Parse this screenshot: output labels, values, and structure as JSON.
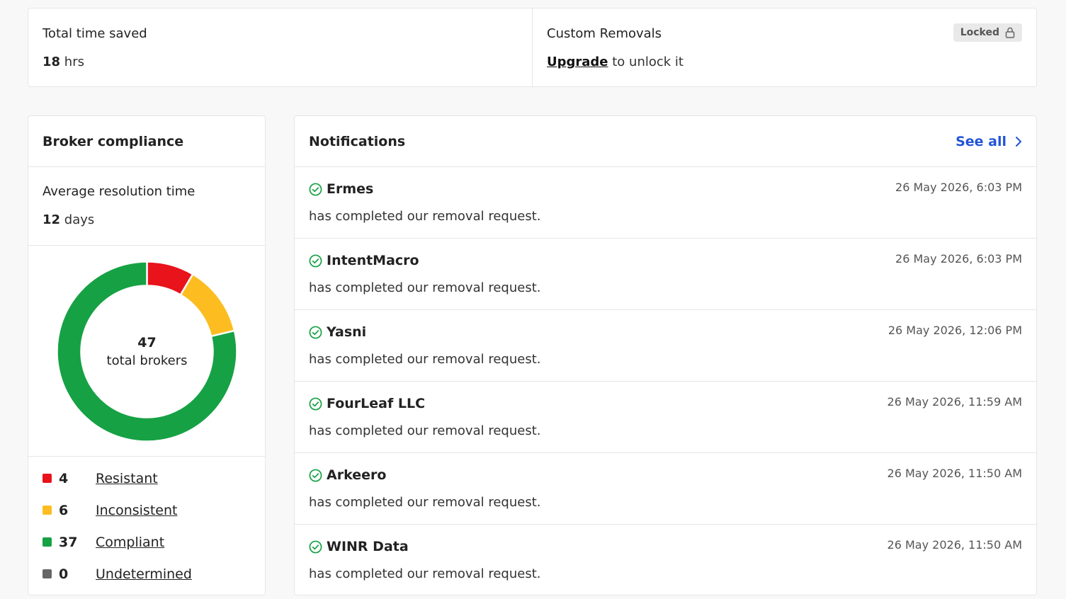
{
  "summary": {
    "time_saved_label": "Total time saved",
    "time_saved_value": "18",
    "time_saved_unit": "hrs",
    "custom_removals_label": "Custom Removals",
    "upgrade_link": "Upgrade",
    "upgrade_suffix": "to unlock it",
    "locked_badge": "Locked"
  },
  "broker": {
    "title": "Broker compliance",
    "resolution_label": "Average resolution time",
    "resolution_value": "12",
    "resolution_unit": "days",
    "total_value": "47",
    "total_label": "total brokers",
    "legend": [
      {
        "count": "4",
        "label": "Resistant",
        "color": "#e8131b"
      },
      {
        "count": "6",
        "label": "Inconsistent",
        "color": "#fdbd20"
      },
      {
        "count": "37",
        "label": "Compliant",
        "color": "#16a144"
      },
      {
        "count": "0",
        "label": "Undetermined",
        "color": "#666666"
      }
    ]
  },
  "chart_data": {
    "type": "pie",
    "categories": [
      "Resistant",
      "Inconsistent",
      "Compliant",
      "Undetermined"
    ],
    "values": [
      4,
      6,
      37,
      0
    ],
    "colors": [
      "#e8131b",
      "#fdbd20",
      "#16a144",
      "#666666"
    ]
  },
  "notifications": {
    "title": "Notifications",
    "see_all": "See all",
    "items": [
      {
        "name": "Ermes",
        "time": "26 May 2026, 6:03 PM",
        "message": "has completed our removal request."
      },
      {
        "name": "IntentMacro",
        "time": "26 May 2026, 6:03 PM",
        "message": "has completed our removal request."
      },
      {
        "name": "Yasni",
        "time": "26 May 2026, 12:06 PM",
        "message": "has completed our removal request."
      },
      {
        "name": "FourLeaf LLC",
        "time": "26 May 2026, 11:59 AM",
        "message": "has completed our removal request."
      },
      {
        "name": "Arkeero",
        "time": "26 May 2026, 11:50 AM",
        "message": "has completed our removal request."
      },
      {
        "name": "WINR Data",
        "time": "26 May 2026, 11:50 AM",
        "message": "has completed our removal request."
      }
    ]
  },
  "colors": {
    "accent": "#2355d6",
    "success": "#16a144"
  }
}
